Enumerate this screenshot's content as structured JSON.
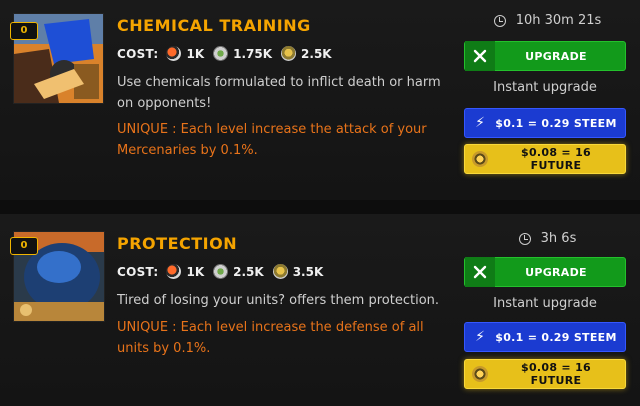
{
  "cards": [
    {
      "level": "0",
      "title": "CHEMICAL TRAINING",
      "cost_label": "COST:",
      "costs": [
        "1K",
        "1.75K",
        "2.5K"
      ],
      "description": "Use chemicals formulated to inflict death or harm on opponents!",
      "unique": "UNIQUE : Each level increase the attack of your Mercenaries by 0.1%.",
      "timer": "10h 30m 21s",
      "upgrade_label": "UPGRADE",
      "instant_label": "Instant upgrade",
      "steem_label": "$0.1 = 0.29 STEEM",
      "future_label": "$0.08 = 16 FUTURE"
    },
    {
      "level": "0",
      "title": "PROTECTION",
      "cost_label": "COST:",
      "costs": [
        "1K",
        "2.5K",
        "3.5K"
      ],
      "description": "Tired of losing your units? offers them protection.",
      "unique": "UNIQUE : Each level increase the defense of all units by 0.1%.",
      "timer": "3h 6s",
      "upgrade_label": "UPGRADE",
      "instant_label": "Instant upgrade",
      "steem_label": "$0.1 = 0.29 STEEM",
      "future_label": "$0.08 = 16 FUTURE"
    }
  ],
  "icons": {
    "resources": [
      "beer-icon",
      "weed-icon",
      "bullet-icon"
    ],
    "upgrade": "tools-icon",
    "steem": "lightning-icon",
    "future": "coin-icon",
    "timer": "clock-icon"
  },
  "colors": {
    "title": "#f5a400",
    "unique": "#e8731a",
    "green": "#129a1b",
    "blue": "#1b3bd1",
    "yellow": "#e7c01a"
  }
}
